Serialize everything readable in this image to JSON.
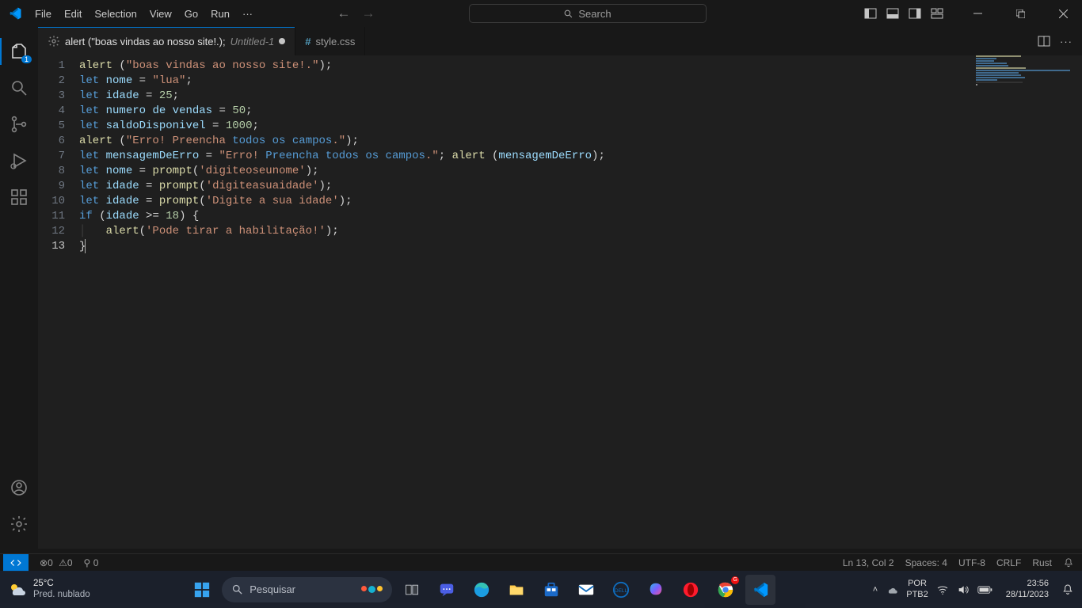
{
  "menu": [
    "File",
    "Edit",
    "Selection",
    "View",
    "Go",
    "Run"
  ],
  "search_placeholder": "Search",
  "tabs": [
    {
      "icon": "settings",
      "name": "alert (\"boas vindas ao nosso site!.);",
      "suffix": "Untitled-1",
      "dirty": true
    },
    {
      "icon": "css",
      "name": "style.css",
      "suffix": "",
      "dirty": false
    }
  ],
  "explorer_badge": "1",
  "code": {
    "lines": [
      [
        [
          "fn",
          "alert"
        ],
        [
          "par",
          " ("
        ],
        [
          "str",
          "\"boas vindas ao nosso site!.\""
        ],
        [
          "par",
          ");"
        ]
      ],
      [
        [
          "kw",
          "let"
        ],
        [
          "par",
          " "
        ],
        [
          "var",
          "nome"
        ],
        [
          "par",
          " = "
        ],
        [
          "str",
          "\"lua\""
        ],
        [
          "par",
          ";"
        ]
      ],
      [
        [
          "kw",
          "let"
        ],
        [
          "par",
          " "
        ],
        [
          "var",
          "idade"
        ],
        [
          "par",
          " = "
        ],
        [
          "num",
          "25"
        ],
        [
          "par",
          ";"
        ]
      ],
      [
        [
          "kw",
          "let"
        ],
        [
          "par",
          " "
        ],
        [
          "var",
          "numero"
        ],
        [
          "par",
          " "
        ],
        [
          "var",
          "de"
        ],
        [
          "par",
          " "
        ],
        [
          "var",
          "vendas"
        ],
        [
          "par",
          " = "
        ],
        [
          "num",
          "50"
        ],
        [
          "par",
          ";"
        ]
      ],
      [
        [
          "kw",
          "let"
        ],
        [
          "par",
          " "
        ],
        [
          "var",
          "saldoDisponivel"
        ],
        [
          "par",
          " = "
        ],
        [
          "num",
          "1000"
        ],
        [
          "par",
          ";"
        ]
      ],
      [
        [
          "fn",
          "alert"
        ],
        [
          "par",
          " ("
        ],
        [
          "str",
          "\"Erro! Preencha "
        ],
        [
          "esc",
          "todos"
        ],
        [
          "str",
          " "
        ],
        [
          "esc",
          "os"
        ],
        [
          "str",
          " "
        ],
        [
          "esc",
          "campos"
        ],
        [
          "str",
          ".\""
        ],
        [
          "par",
          ");"
        ]
      ],
      [
        [
          "kw",
          "let"
        ],
        [
          "par",
          " "
        ],
        [
          "var",
          "mensagemDeErro"
        ],
        [
          "par",
          " = "
        ],
        [
          "str",
          "\"Erro! "
        ],
        [
          "esc",
          "Preencha"
        ],
        [
          "str",
          " "
        ],
        [
          "esc",
          "todos"
        ],
        [
          "str",
          " "
        ],
        [
          "esc",
          "os"
        ],
        [
          "str",
          " "
        ],
        [
          "esc",
          "campos"
        ],
        [
          "str",
          ".\""
        ],
        [
          "par",
          "; "
        ],
        [
          "fn",
          "alert"
        ],
        [
          "par",
          " ("
        ],
        [
          "var",
          "mensagemDeErro"
        ],
        [
          "par",
          ");"
        ]
      ],
      [
        [
          "kw",
          "let"
        ],
        [
          "par",
          " "
        ],
        [
          "var",
          "nome"
        ],
        [
          "par",
          " = "
        ],
        [
          "fn",
          "prompt"
        ],
        [
          "par",
          "("
        ],
        [
          "str",
          "'digiteoseunome'"
        ],
        [
          "par",
          ");"
        ]
      ],
      [
        [
          "kw",
          "let"
        ],
        [
          "par",
          " "
        ],
        [
          "var",
          "idade"
        ],
        [
          "par",
          " = "
        ],
        [
          "fn",
          "prompt"
        ],
        [
          "par",
          "("
        ],
        [
          "str",
          "'digiteasuaidade'"
        ],
        [
          "par",
          ");"
        ]
      ],
      [
        [
          "kw",
          "let"
        ],
        [
          "par",
          " "
        ],
        [
          "var",
          "idade"
        ],
        [
          "par",
          " = "
        ],
        [
          "fn",
          "prompt"
        ],
        [
          "par",
          "("
        ],
        [
          "str",
          "'Digite a sua idade'"
        ],
        [
          "par",
          ");"
        ]
      ],
      [
        [
          "kw",
          "if"
        ],
        [
          "par",
          " ("
        ],
        [
          "var",
          "idade"
        ],
        [
          "par",
          " >= "
        ],
        [
          "num",
          "18"
        ],
        [
          "par",
          ") {"
        ]
      ],
      [
        [
          "guide",
          "│   "
        ],
        [
          "fn",
          "alert"
        ],
        [
          "par",
          "("
        ],
        [
          "str",
          "'Pode tirar a habilitação!'"
        ],
        [
          "par",
          ");"
        ]
      ],
      [
        [
          "par",
          "}"
        ],
        [
          "cursor",
          ""
        ]
      ]
    ],
    "current_line": 13
  },
  "status": {
    "errors": "0",
    "warnings": "0",
    "ports": "0",
    "position": "Ln 13, Col 2",
    "spaces": "Spaces: 4",
    "encoding": "UTF-8",
    "eol": "CRLF",
    "language": "Rust"
  },
  "taskbar": {
    "weather_temp": "25°C",
    "weather_text": "Pred. nublado",
    "search_placeholder": "Pesquisar",
    "lang1": "POR",
    "lang2": "PTB2",
    "time": "23:56",
    "date": "28/11/2023"
  }
}
